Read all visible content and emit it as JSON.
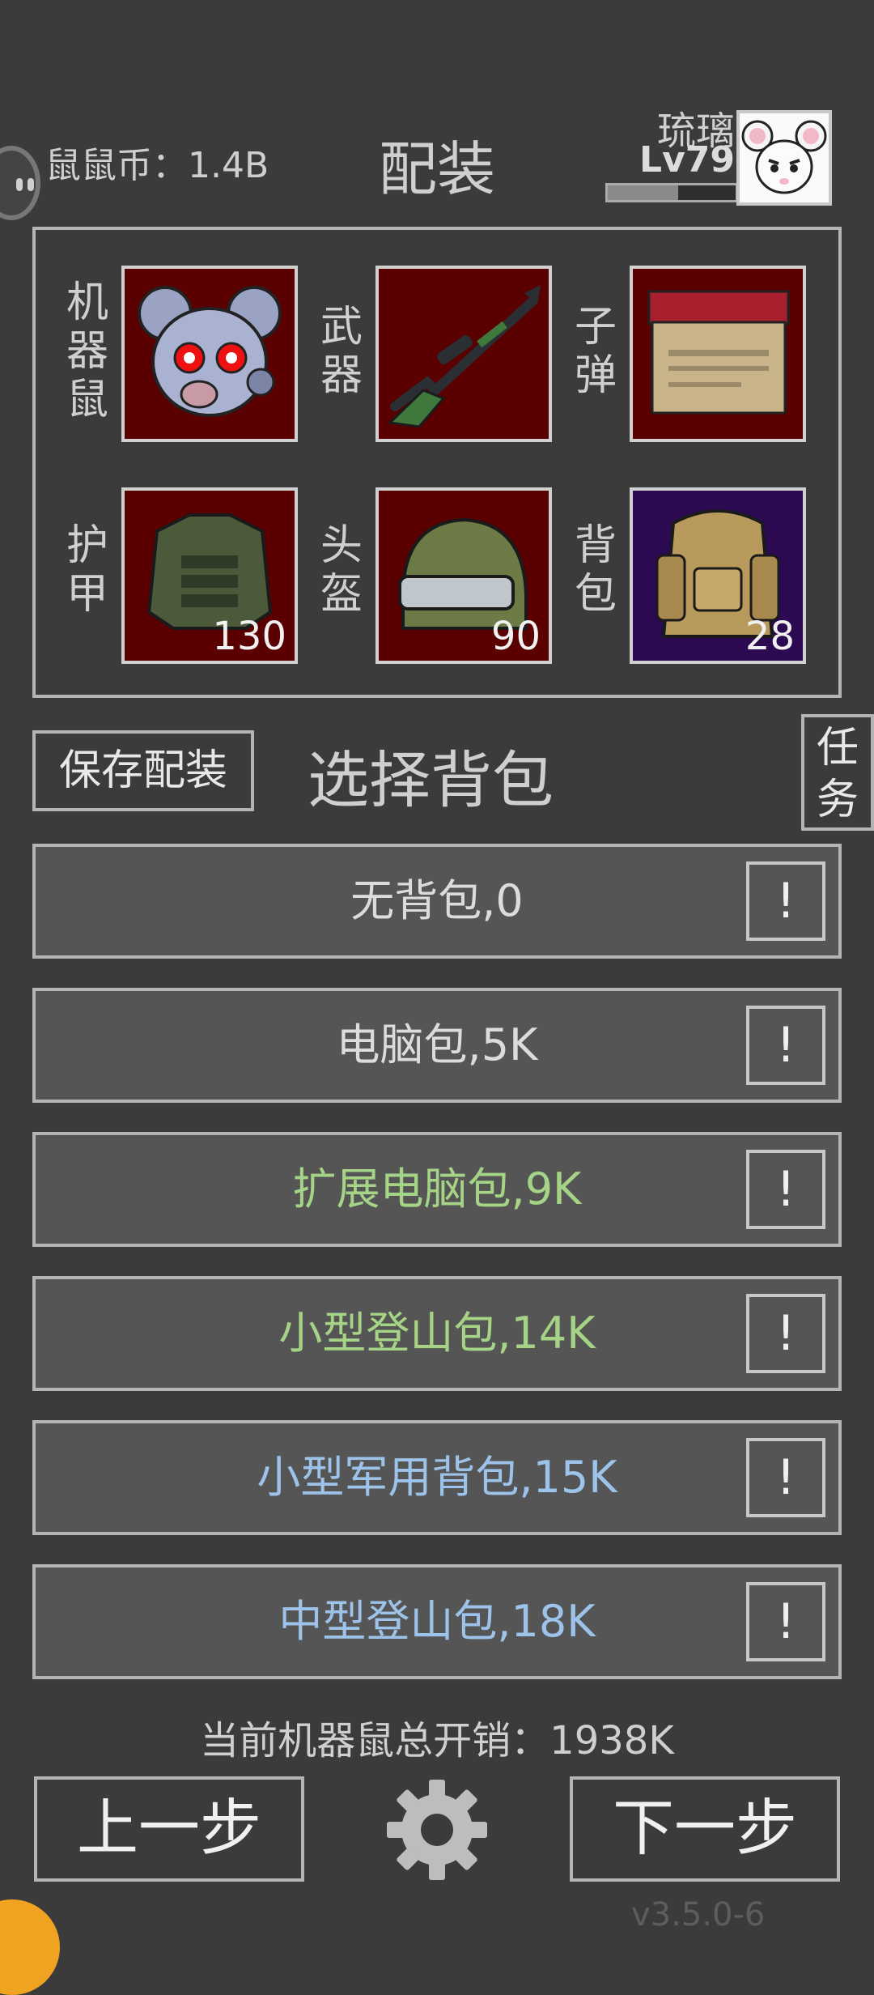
{
  "header": {
    "coins_label": "鼠鼠币：1.4B",
    "title": "配装",
    "player_name": "琉璃",
    "player_level": "Lv79",
    "xp_progress": 0.55
  },
  "loadout": {
    "slots": [
      {
        "label": "机器鼠",
        "item": "robot-mouse-head",
        "count": ""
      },
      {
        "label": "武器",
        "item": "sniper-rifle",
        "count": ""
      },
      {
        "label": "子弹",
        "item": "ammo-box",
        "count": ""
      },
      {
        "label": "护甲",
        "item": "body-armor",
        "count": "130"
      },
      {
        "label": "头盔",
        "item": "helmet",
        "count": "90"
      },
      {
        "label": "背包",
        "item": "backpack",
        "count": "28"
      }
    ]
  },
  "actions": {
    "save_label": "保存配装",
    "section_title": "选择背包",
    "task_label": "任务"
  },
  "backpacks": [
    {
      "label": "无背包,0",
      "color": "#dcdcdc"
    },
    {
      "label": "电脑包,5K",
      "color": "#dcdcdc"
    },
    {
      "label": "扩展电脑包,9K",
      "color": "#a6d486"
    },
    {
      "label": "小型登山包,14K",
      "color": "#a6d486"
    },
    {
      "label": "小型军用背包,15K",
      "color": "#9dc3ea"
    },
    {
      "label": "中型登山包,18K",
      "color": "#9dc3ea"
    }
  ],
  "info_symbol": "!",
  "footer": {
    "total_cost": "当前机器鼠总开销：1938K",
    "prev_label": "上一步",
    "next_label": "下一步",
    "version": "v3.5.0-6"
  },
  "colors": {
    "background": "#3b3b3b",
    "slot_red": "#5a0000",
    "slot_purple": "#2b0a52"
  }
}
